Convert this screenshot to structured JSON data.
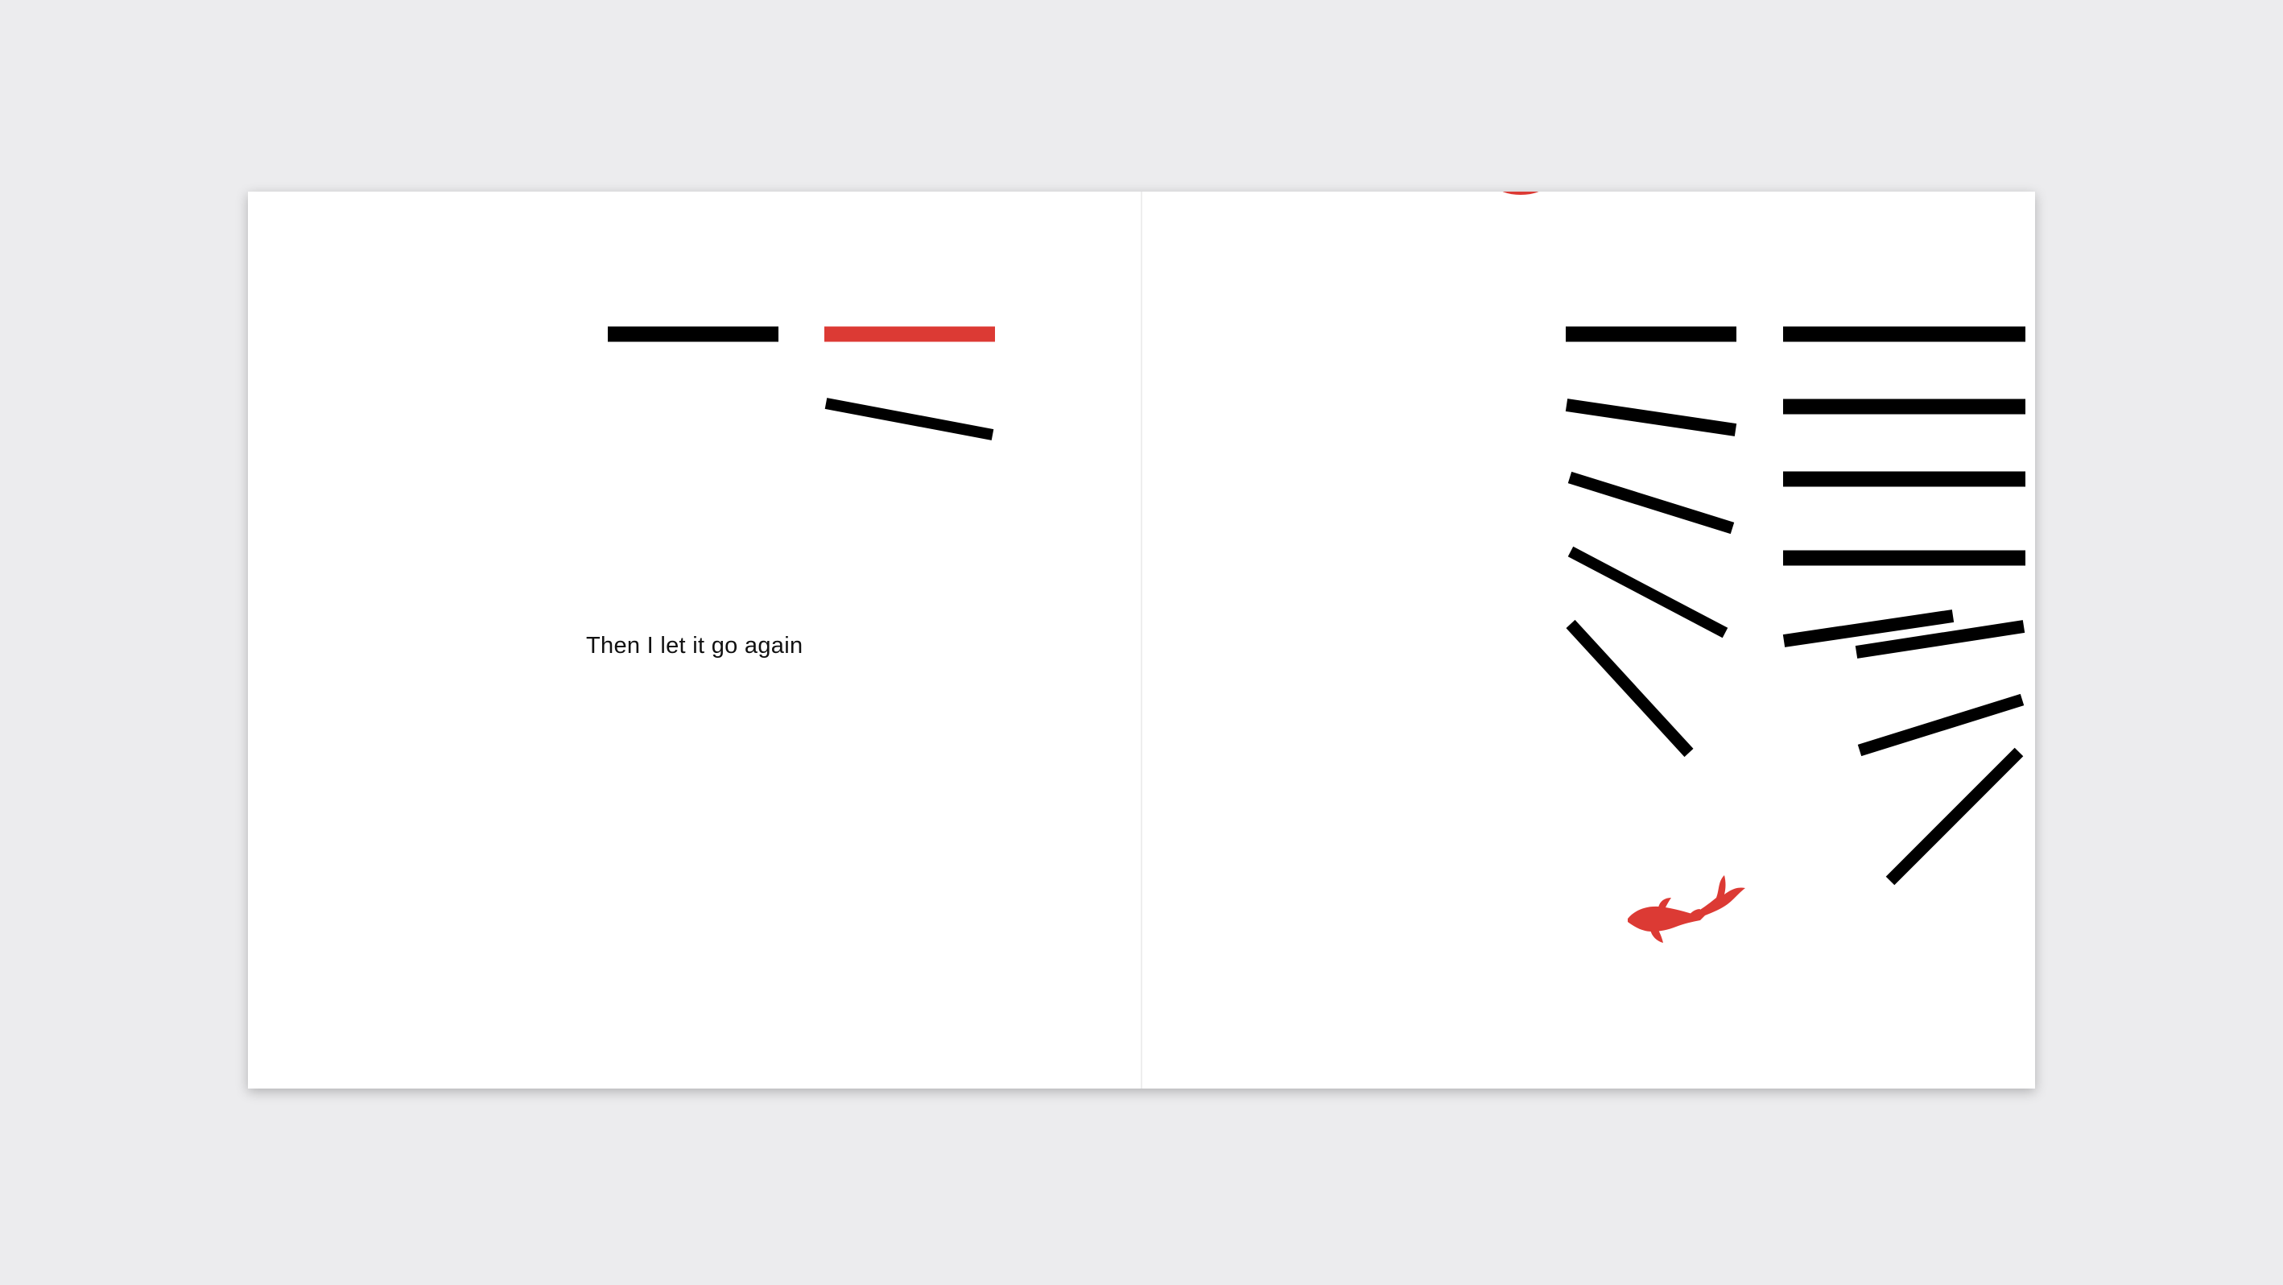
{
  "book": {
    "left_page": {
      "text": "Then I let it go again"
    }
  },
  "colors": {
    "background": "#ececee",
    "page": "#ffffff",
    "stroke": "#000000",
    "accent": "#dc3a34"
  },
  "icons": {
    "fish": "koi-fish-icon"
  }
}
